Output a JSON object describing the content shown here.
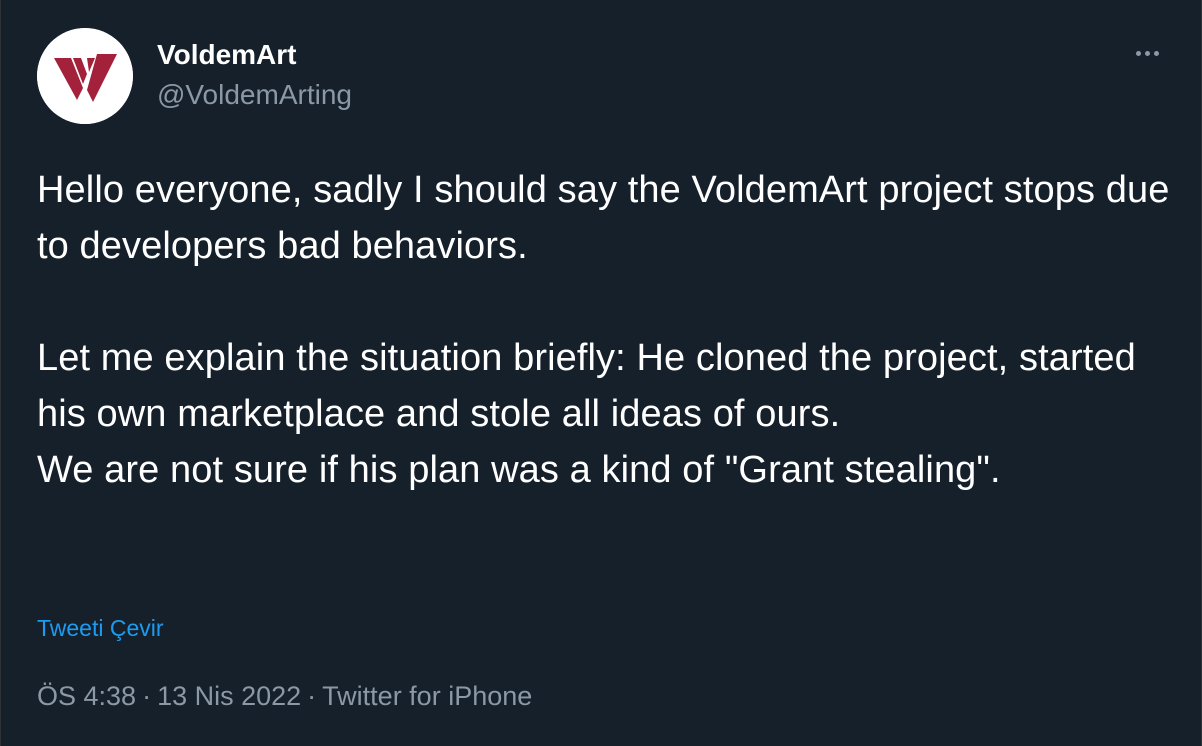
{
  "author": {
    "display_name": "VoldemArt",
    "handle": "@VoldemArting",
    "avatar_icon": "voldemart-logo-icon",
    "avatar_colors": {
      "background": "#ffffff",
      "mark": "#a3213a"
    }
  },
  "more_icon": "more-options-icon",
  "tweet": {
    "paragraph_1": "Hello everyone, sadly I should say the VoldemArt project stops due to developers bad behaviors.",
    "paragraph_2": "Let me explain the situation briefly: He cloned the project, started his own marketplace and stole all ideas of ours.",
    "paragraph_3": "We are not sure if his plan was a kind of \"Grant stealing\".",
    "translate_label": "Tweeti Çevir"
  },
  "meta": {
    "time": "ÖS 4:38",
    "separator": "·",
    "date": "13 Nis 2022",
    "source": "Twitter for iPhone"
  },
  "colors": {
    "background": "#15202b",
    "text_primary": "#ffffff",
    "text_secondary": "#8b98a5",
    "link": "#1d9bf0"
  }
}
